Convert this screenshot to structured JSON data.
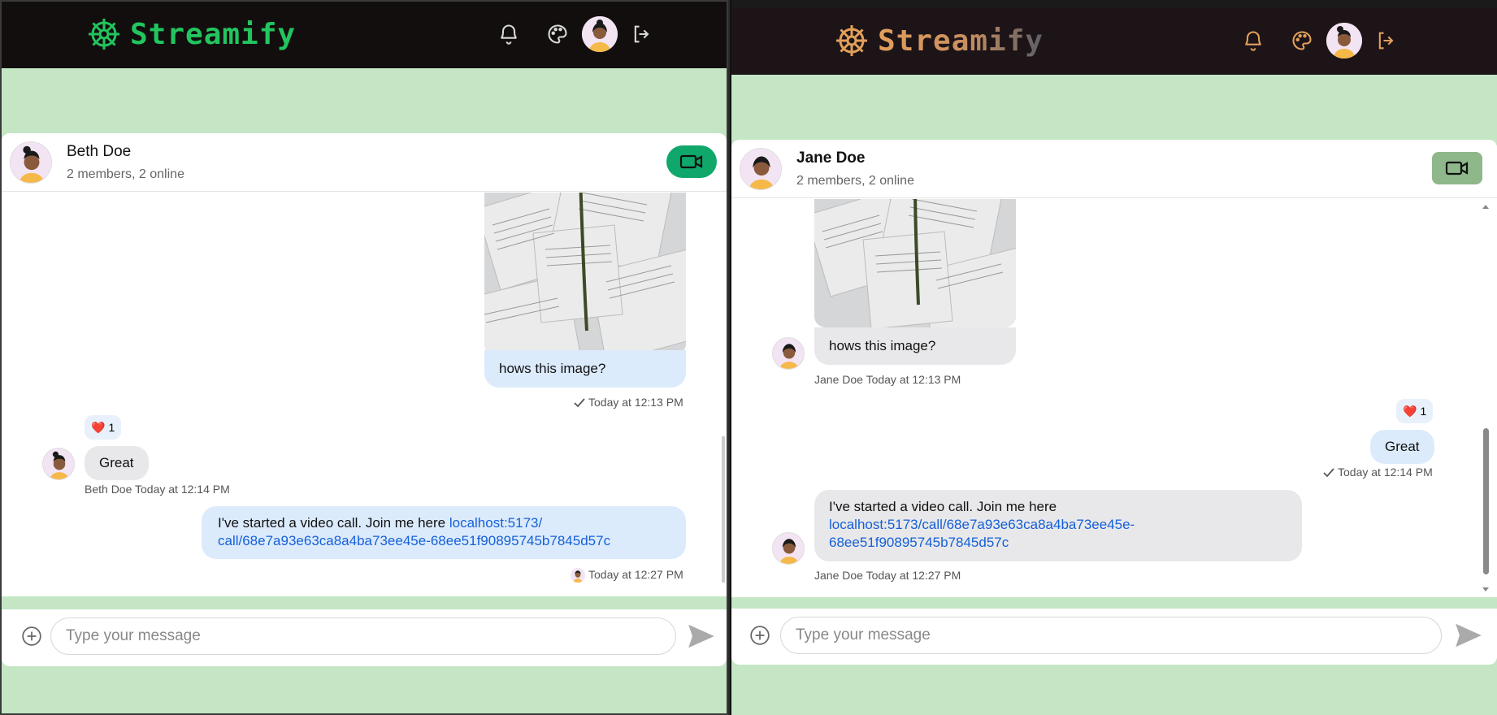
{
  "app": {
    "name": "Streamify"
  },
  "left": {
    "navbar": {
      "brand": "Streamify",
      "brand_color": "#22c55e"
    },
    "header": {
      "name": "Beth Doe",
      "subtitle": "2 members, 2 online",
      "video_btn_color": "#0fa86a"
    },
    "messages": [
      {
        "type": "image",
        "sender": "me",
        "caption": "hows this image?",
        "meta": "Today at 12:13 PM",
        "status_icon": "check-icon"
      },
      {
        "type": "text",
        "sender": "Beth Doe",
        "text": "Great",
        "reaction": {
          "emoji": "❤️",
          "count": "1"
        },
        "meta": "Beth Doe Today at 12:14 PM"
      },
      {
        "type": "text",
        "sender": "me",
        "text": "I've started a video call. Join me here ",
        "link_line1": "localhost:5173/",
        "link_line2": "call/68e7a93e63ca8a4ba73ee45e-68ee51f90895745b7845d57c",
        "meta": "Today at 12:27 PM"
      }
    ],
    "input": {
      "placeholder": "Type your message"
    }
  },
  "right": {
    "navbar": {
      "brand": "Streamify",
      "brand_color": "#e2a05a"
    },
    "header": {
      "name": "Jane Doe",
      "subtitle": "2 members, 2 online",
      "video_btn_color": "#8fb88a"
    },
    "messages": [
      {
        "type": "image",
        "sender": "Jane Doe",
        "caption": "hows this image?",
        "meta": "Jane Doe Today at 12:13 PM"
      },
      {
        "type": "text",
        "sender": "me",
        "text": "Great",
        "reaction": {
          "emoji": "❤️",
          "count": "1"
        },
        "meta": "Today at 12:14 PM",
        "status_icon": "check-icon"
      },
      {
        "type": "text",
        "sender": "Jane Doe",
        "text": "I've started a video call. Join me here",
        "link_line1": "localhost:5173/call/68e7a93e63ca8a4ba73ee45e-",
        "link_line2": "68ee51f90895745b7845d57c",
        "meta": "Jane Doe Today at 12:27 PM"
      }
    ],
    "input": {
      "placeholder": "Type your message"
    }
  },
  "icons": [
    "steering-wheel-icon",
    "bell-icon",
    "palette-icon",
    "logout-icon",
    "video-camera-icon",
    "plus-circle-icon",
    "send-icon",
    "check-icon"
  ]
}
